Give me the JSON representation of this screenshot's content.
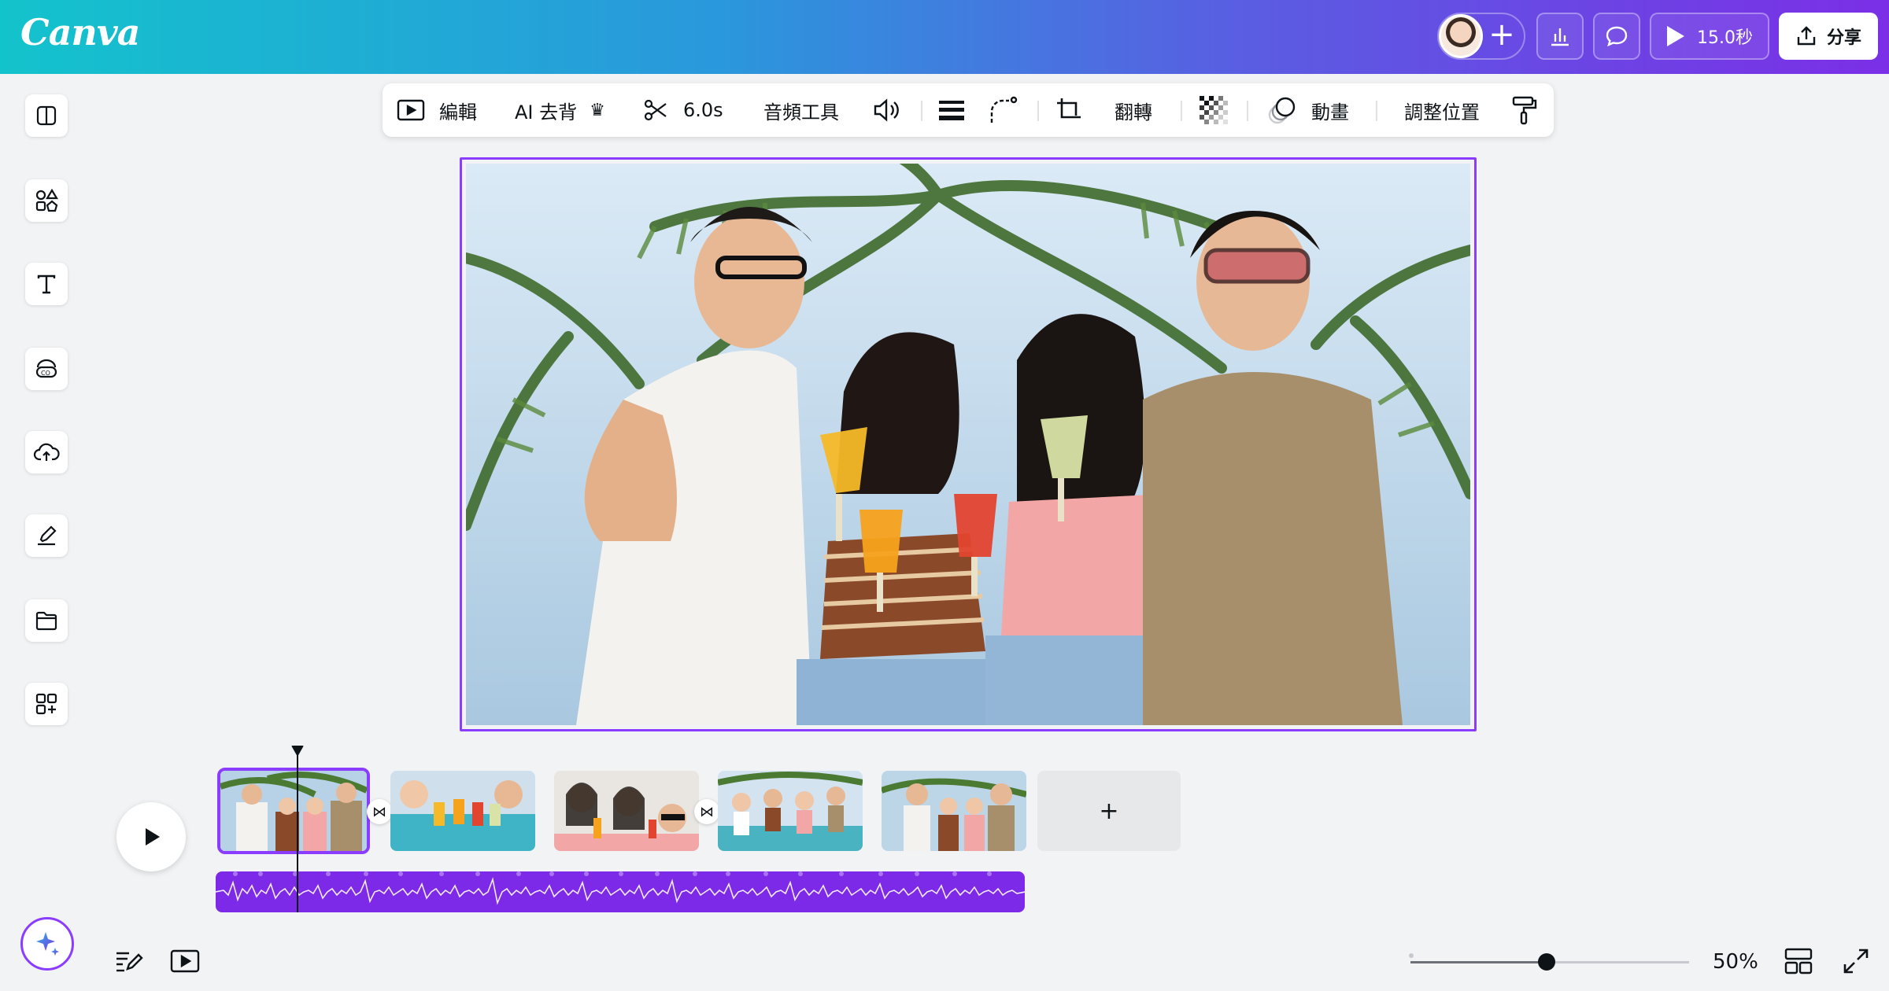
{
  "app": {
    "logo": "Canva"
  },
  "header": {
    "play_duration": "15.0秒",
    "share_label": "分享"
  },
  "sidebar": {
    "items": [
      "layout",
      "elements",
      "text",
      "brand",
      "uploads",
      "draw",
      "projects",
      "apps"
    ]
  },
  "toolbar": {
    "edit_label": "編輯",
    "ai_bg_label": "AI 去背",
    "duration_label": "6.0s",
    "audio_tools_label": "音頻工具",
    "flip_label": "翻轉",
    "animate_label": "動畫",
    "position_label": "調整位置"
  },
  "timeline": {
    "clip_count": 5,
    "selected_clip": 1,
    "add_clip_label": "+"
  },
  "footer": {
    "zoom_label": "50%",
    "zoom_value": 0.5
  },
  "colors": {
    "accent": "#8b3dff",
    "audio_track": "#7d2ae8",
    "header_start": "#13c3cc",
    "header_end": "#7b2fe6"
  }
}
